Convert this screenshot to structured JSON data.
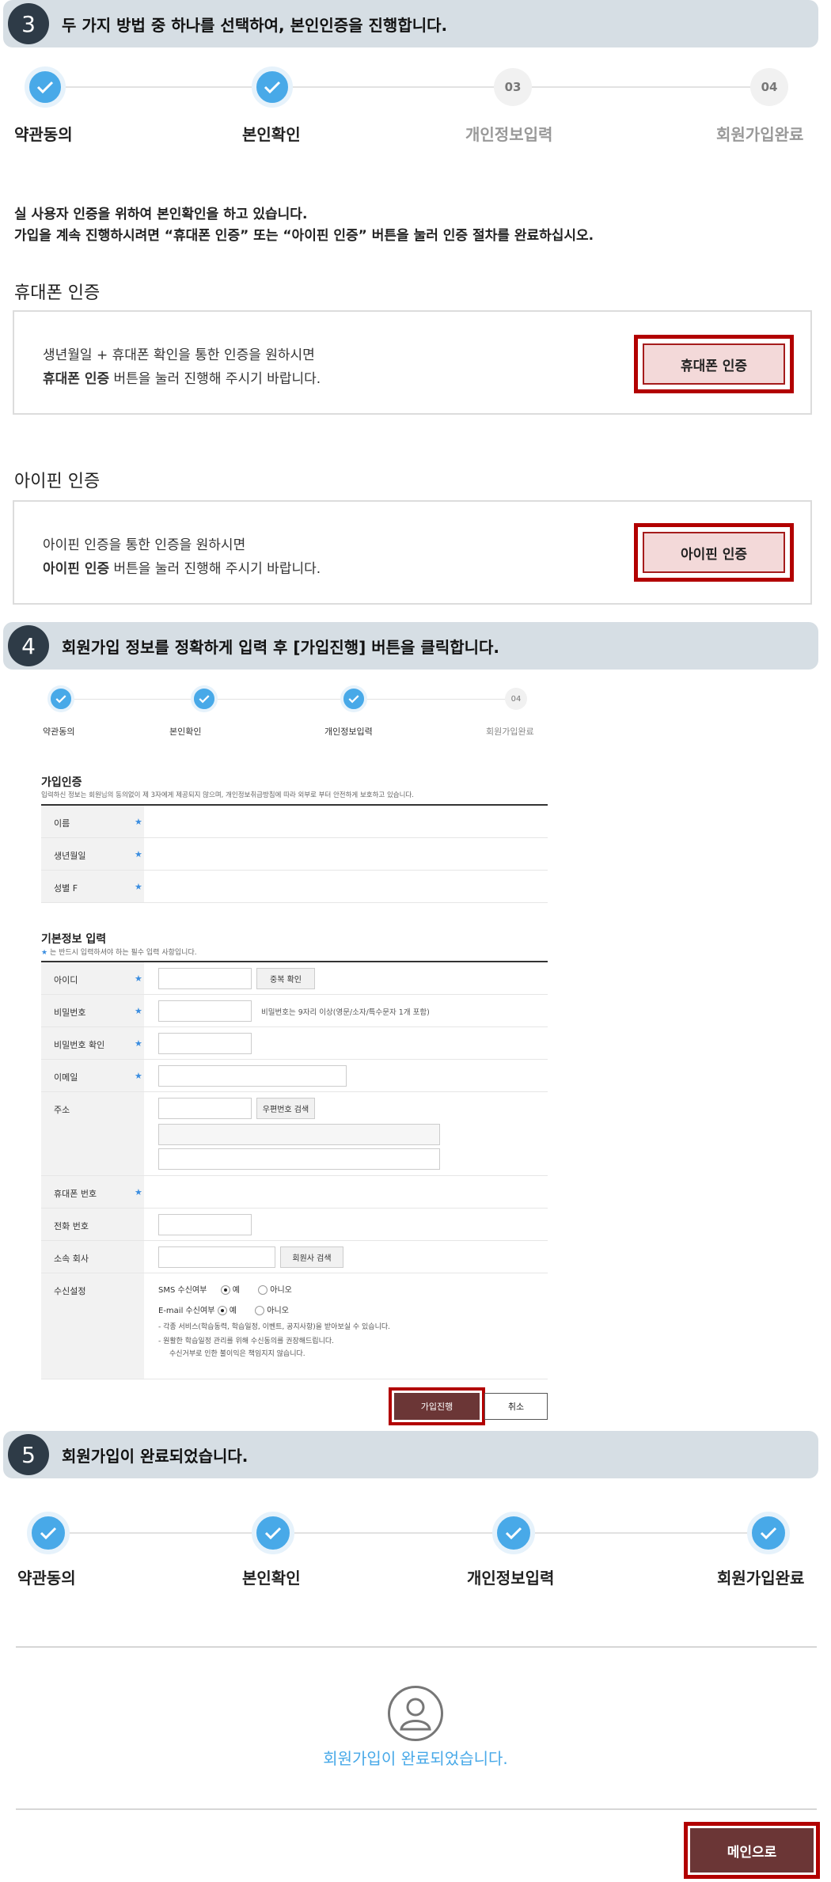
{
  "section3": {
    "num": "3",
    "title": "두 가지 방법 중 하나를 선택하여, 본인인증을 진행합니다.",
    "steps": [
      {
        "label": "약관동의",
        "state": "done"
      },
      {
        "label": "본인확인",
        "state": "done"
      },
      {
        "label": "개인정보입력",
        "state": "pending",
        "num": "03"
      },
      {
        "label": "회원가입완료",
        "state": "pending",
        "num": "04"
      }
    ],
    "intro_line1": "실 사용자 인증을 위하여 본인확인을 하고 있습니다.",
    "intro_line2": "가입을 계속 진행하시려면 “휴대폰 인증” 또는 “아이핀 인증” 버튼을 눌러 인증 절차를 완료하십시오.",
    "phone": {
      "heading": "휴대폰 인증",
      "desc1": "생년월일 + 휴대폰 확인을 통한 인증을 원하시면",
      "desc2_bold": "휴대폰 인증",
      "desc2_rest": " 버튼을 눌러 진행해 주시기 바랍니다.",
      "button": "휴대폰 인증"
    },
    "ipin": {
      "heading": "아이핀 인증",
      "desc1": "아이핀 인증을 통한 인증을 원하시면",
      "desc2_bold": "아이핀 인증",
      "desc2_rest": " 버튼을 눌러 진행해 주시기 바랍니다.",
      "button": "아이핀 인증"
    }
  },
  "section4": {
    "num": "4",
    "title": "회원가입 정보를 정확하게 입력 후 [가입진행] 버튼을 클릭합니다.",
    "steps": [
      {
        "label": "약관동의",
        "state": "done"
      },
      {
        "label": "본인확인",
        "state": "done"
      },
      {
        "label": "개인정보입력",
        "state": "done"
      },
      {
        "label": "회원가입완료",
        "state": "pending",
        "num": "04"
      }
    ],
    "auth_title": "가입인증",
    "auth_note": "입력하신 정보는 회원님의 동의없이 제 3자에게 제공되지 않으며, 개인정보취급방침에 따라 외부로 부터 안전하게 보호하고 있습니다.",
    "auth_fields": [
      "이름",
      "생년월일",
      "성별 F"
    ],
    "basic_title": "기본정보 입력",
    "basic_note": "는 반드시 입력하셔야 하는 필수 입력 사항입니다.",
    "fields": {
      "id": "아이디",
      "id_btn": "중복 확인",
      "pw": "비밀번호",
      "pw_hint": "비밀번호는 9자리 이상(영문/소자/특수문자 1개 포함)",
      "pw_confirm": "비밀번호 확인",
      "email": "이메일",
      "address": "주소",
      "address_btn": "우편번호 검색",
      "mobile": "휴대폰 번호",
      "phone": "전화 번호",
      "company": "소속 회사",
      "company_btn": "회원사 검색",
      "receive": "수신설정",
      "sms_label": "SMS 수신여부",
      "email_label": "E-mail 수신여부",
      "yes": "예",
      "no": "아니오",
      "note1": "-  각종 서비스(학습동력, 학습일정, 이벤트, 공지사항)을 받아보실 수 있습니다.",
      "note2": "-  원활한 학습일정 관리를 위해 수신동의를 권장해드립니다.",
      "note3": "수신거부로 인한 불이익은 책임지지 않습니다."
    },
    "submit": "가입진행",
    "cancel": "취소"
  },
  "section5": {
    "num": "5",
    "title": "회원가입이 완료되었습니다.",
    "steps": [
      {
        "label": "약관동의",
        "state": "done"
      },
      {
        "label": "본인확인",
        "state": "done"
      },
      {
        "label": "개인정보입력",
        "state": "done"
      },
      {
        "label": "회원가입완료",
        "state": "done"
      }
    ],
    "complete_msg": "회원가입이 완료되었습니다.",
    "main_button": "메인으로"
  },
  "colors": {
    "accent": "#48a9e8",
    "banner": "#d6dee4",
    "highlight": "#b20000",
    "dark_button": "#6b3636"
  }
}
